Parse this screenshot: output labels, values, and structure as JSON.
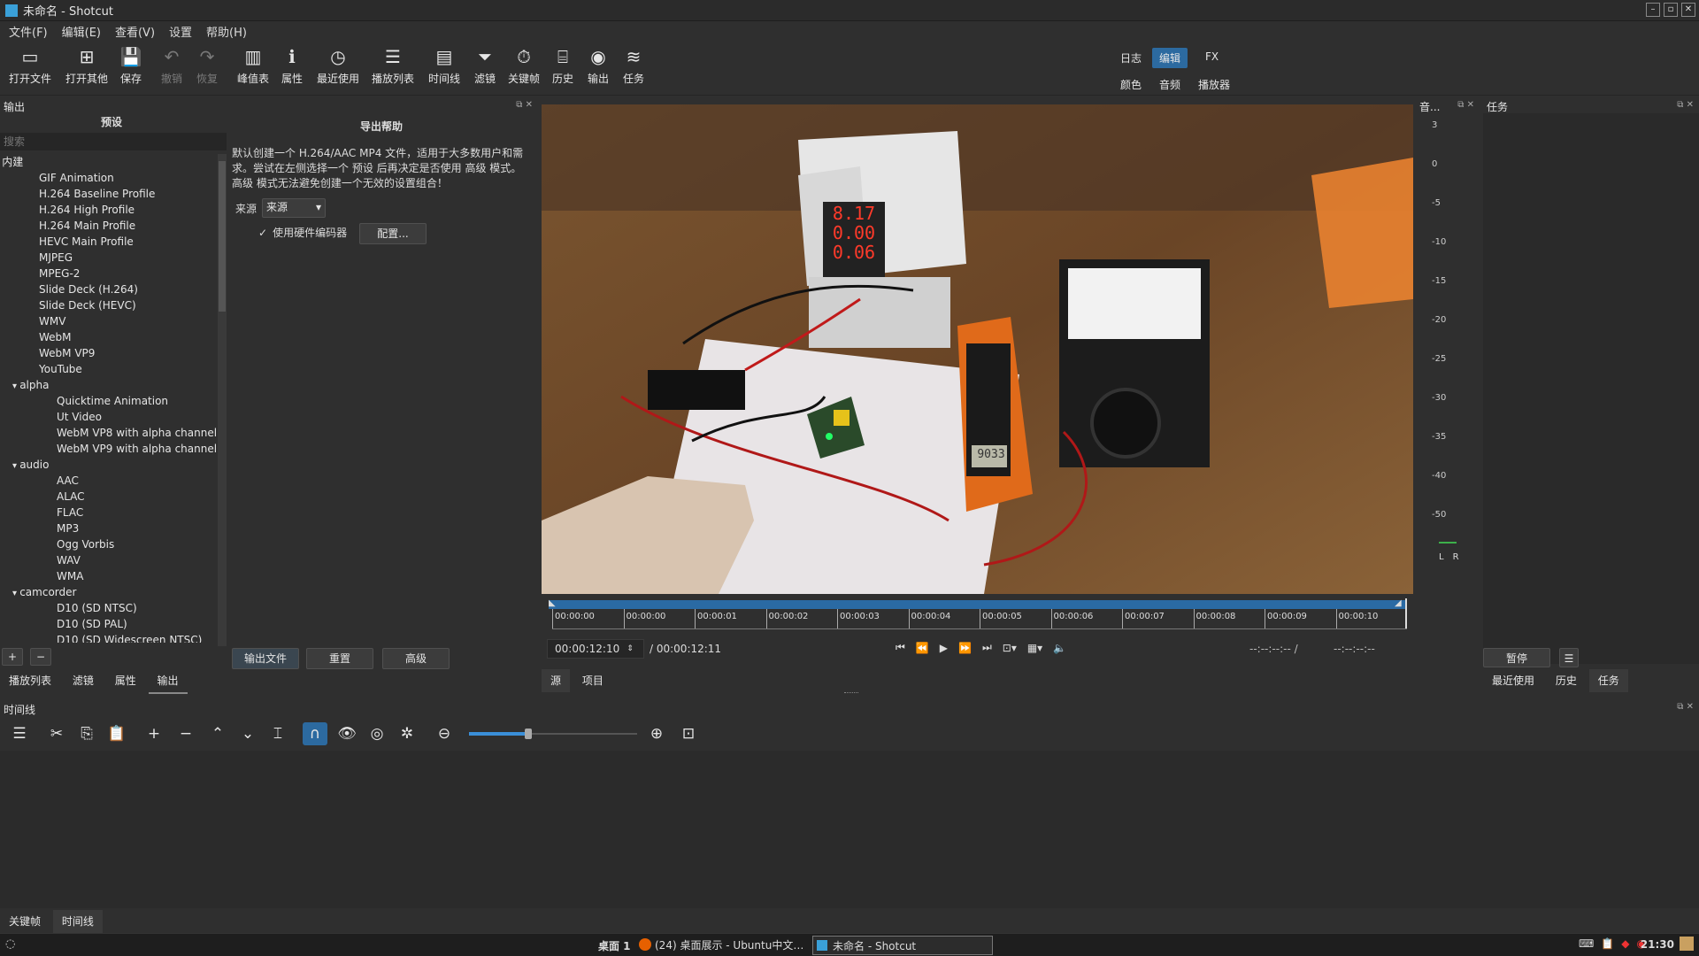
{
  "window": {
    "title": "未命名 - Shotcut",
    "controls": [
      "–",
      "▫",
      "✕"
    ]
  },
  "menu": [
    "文件(F)",
    "编辑(E)",
    "查看(V)",
    "设置",
    "帮助(H)"
  ],
  "toolbar": {
    "items": [
      {
        "label": "打开文件",
        "icon": "▭"
      },
      {
        "label": "打开其他",
        "icon": "⊞"
      },
      {
        "label": "保存",
        "icon": "💾"
      },
      {
        "label": "撤销",
        "icon": "↶"
      },
      {
        "label": "恢复",
        "icon": "↷"
      },
      {
        "label": "峰值表",
        "icon": "▥"
      },
      {
        "label": "属性",
        "icon": "ℹ"
      },
      {
        "label": "最近使用",
        "icon": "◷"
      },
      {
        "label": "播放列表",
        "icon": "☰"
      },
      {
        "label": "时间线",
        "icon": "▤"
      },
      {
        "label": "滤镜",
        "icon": "⏷"
      },
      {
        "label": "关键帧",
        "icon": "⏱"
      },
      {
        "label": "历史",
        "icon": "⌸"
      },
      {
        "label": "输出",
        "icon": "◉"
      },
      {
        "label": "任务",
        "icon": "≋"
      }
    ],
    "layouts_top": [
      "日志",
      "编辑",
      "FX"
    ],
    "layouts_bottom": [
      "颜色",
      "音频",
      "播放器"
    ]
  },
  "output_panel": {
    "title": "输出",
    "presets_header": "预设",
    "search_placeholder": "搜索",
    "tree": [
      {
        "text": "内建",
        "level": 0,
        "group": true
      },
      {
        "text": "GIF Animation",
        "level": 1
      },
      {
        "text": "H.264 Baseline Profile",
        "level": 1
      },
      {
        "text": "H.264 High Profile",
        "level": 1
      },
      {
        "text": "H.264 Main Profile",
        "level": 1
      },
      {
        "text": "HEVC Main Profile",
        "level": 1
      },
      {
        "text": "MJPEG",
        "level": 1
      },
      {
        "text": "MPEG-2",
        "level": 1
      },
      {
        "text": "Slide Deck (H.264)",
        "level": 1
      },
      {
        "text": "Slide Deck (HEVC)",
        "level": 1
      },
      {
        "text": "WMV",
        "level": 1
      },
      {
        "text": "WebM",
        "level": 1
      },
      {
        "text": "WebM VP9",
        "level": 1
      },
      {
        "text": "YouTube",
        "level": 1
      },
      {
        "text": "alpha",
        "level": 1,
        "group": true
      },
      {
        "text": "Quicktime Animation",
        "level": 2
      },
      {
        "text": "Ut Video",
        "level": 2
      },
      {
        "text": "WebM VP8 with alpha channel",
        "level": 2
      },
      {
        "text": "WebM VP9 with alpha channel",
        "level": 2
      },
      {
        "text": "audio",
        "level": 1,
        "group": true
      },
      {
        "text": "AAC",
        "level": 2
      },
      {
        "text": "ALAC",
        "level": 2
      },
      {
        "text": "FLAC",
        "level": 2
      },
      {
        "text": "MP3",
        "level": 2
      },
      {
        "text": "Ogg Vorbis",
        "level": 2
      },
      {
        "text": "WAV",
        "level": 2
      },
      {
        "text": "WMA",
        "level": 2
      },
      {
        "text": "camcorder",
        "level": 1,
        "group": true
      },
      {
        "text": "D10 (SD NTSC)",
        "level": 2
      },
      {
        "text": "D10 (SD PAL)",
        "level": 2
      },
      {
        "text": "D10 (SD Widescreen NTSC)",
        "level": 2
      }
    ],
    "add_btn": "+",
    "remove_btn": "−"
  },
  "export_help": {
    "title": "导出帮助",
    "text": "默认创建一个 H.264/AAC MP4 文件，适用于大多数用户和需求。尝试在左侧选择一个 预设 后再决定是否使用 高级 模式。高级 模式无法避免创建一个无效的设置组合！",
    "source_label": "来源",
    "source_value": "来源",
    "hw_encoder_label": "使用硬件编码器",
    "config_btn": "配置...",
    "export_btn": "输出文件",
    "reset_btn": "重置",
    "advanced_btn": "高级"
  },
  "player": {
    "ruler": [
      "00:00:00",
      "00:00:00",
      "00:00:01",
      "00:00:02",
      "00:00:03",
      "00:00:04",
      "00:00:05",
      "00:00:06",
      "00:00:07",
      "00:00:08",
      "00:00:09",
      "00:00:10"
    ],
    "position": "00:00:12:10",
    "duration": "/ 00:00:12:11",
    "in_point": "--:--:--:-- /",
    "out_point": "--:--:--:--",
    "tabs": [
      "源",
      "项目"
    ],
    "display_7seg": [
      "8.17",
      "0.00",
      "0.06"
    ],
    "clamp_meter": "9033"
  },
  "meter": {
    "title": "音...",
    "scale": [
      "3",
      "0",
      "-5",
      "-10",
      "-15",
      "-20",
      "-25",
      "-30",
      "-35",
      "-40",
      "-50"
    ],
    "channels": [
      "L",
      "R"
    ]
  },
  "jobs": {
    "title": "任务",
    "pause_btn": "暂停",
    "menu_btn": "☰",
    "tabs": [
      "最近使用",
      "历史",
      "任务"
    ]
  },
  "left_tabs": [
    "播放列表",
    "滤镜",
    "属性",
    "输出"
  ],
  "timeline": {
    "title": "时间线",
    "tools": [
      {
        "name": "menu-icon",
        "glyph": "☰"
      },
      {
        "name": "cut-icon",
        "glyph": "✂"
      },
      {
        "name": "copy-icon",
        "glyph": "⎘"
      },
      {
        "name": "paste-icon",
        "glyph": "📋"
      },
      {
        "name": "append-icon",
        "glyph": "+"
      },
      {
        "name": "ripple-delete-icon",
        "glyph": "−"
      },
      {
        "name": "lift-icon",
        "glyph": "⌃"
      },
      {
        "name": "overwrite-icon",
        "glyph": "⌄"
      },
      {
        "name": "split-icon",
        "glyph": "⌶"
      },
      {
        "name": "snap-icon",
        "glyph": "∩"
      },
      {
        "name": "scrub-icon",
        "glyph": "👁"
      },
      {
        "name": "ripple-icon",
        "glyph": "◎"
      },
      {
        "name": "ripple-all-icon",
        "glyph": "✲"
      },
      {
        "name": "zoom-out-icon",
        "glyph": "⊖"
      },
      {
        "name": "zoom-in-icon",
        "glyph": "⊕"
      },
      {
        "name": "zoom-fit-icon",
        "glyph": "⊡"
      }
    ],
    "zoom_level": 0.35,
    "bottom_tabs": [
      "关键帧",
      "时间线"
    ]
  },
  "taskbar": {
    "desktop": "桌面 1",
    "app1": "(24) 桌面展示 - Ubuntu中文…",
    "app2": "未命名 - Shotcut",
    "clock": "21:30"
  }
}
